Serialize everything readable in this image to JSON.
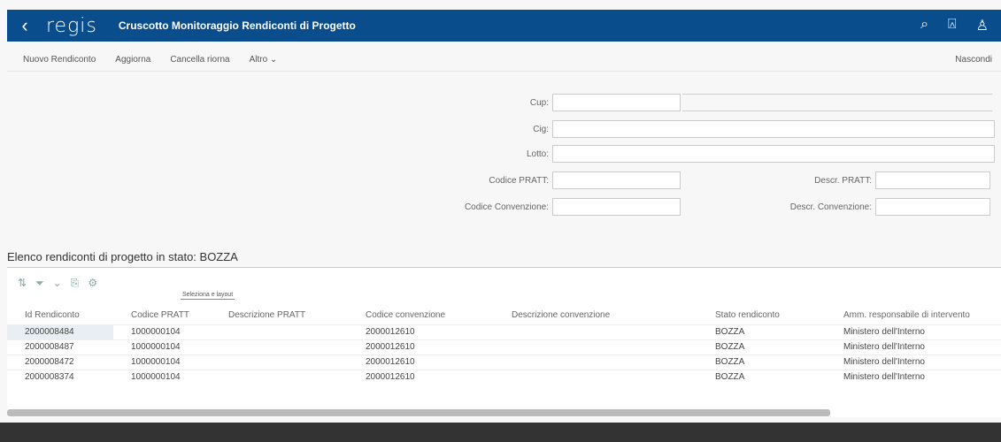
{
  "header": {
    "back_icon": "chevron-left-icon",
    "logo": "regis",
    "title": "Cruscotto Monitoraggio Rendiconti di Progetto",
    "icons": [
      "search-icon",
      "bell-icon",
      "user-icon"
    ]
  },
  "toolbar": {
    "items": [
      "Nuovo Rendiconto",
      "Aggiorna",
      "Cancella riorna",
      "Altro"
    ],
    "right": "Nascondi"
  },
  "form": {
    "cup_label": "Cup:",
    "cig_label": "Cig:",
    "lotto_label": "Lotto:",
    "pratt_label": "Codice PRATT:",
    "descr_pratt_label": "Descr. PRATT:",
    "conv_label": "Codice Convenzione:",
    "descr_conv_label": "Descr. Convenzione:"
  },
  "table": {
    "title": "Elenco rendiconti di progetto in stato: BOZZA",
    "tooltip": "Seleziona e layout",
    "columns": [
      "Id Rendiconto",
      "Codice PRATT",
      "Descrizione PRATT",
      "Codice convenzione",
      "Descrizione convenzione",
      "Stato rendiconto",
      "Amm. responsabile di intervento"
    ],
    "rows": [
      [
        "2000008484",
        "1000000104",
        "",
        "2000012610",
        "",
        "BOZZA",
        "Ministero dell'Interno"
      ],
      [
        "2000008487",
        "1000000104",
        "",
        "2000012610",
        "",
        "BOZZA",
        "Ministero dell'Interno"
      ],
      [
        "2000008472",
        "1000000104",
        "",
        "2000012610",
        "",
        "BOZZA",
        "Ministero dell'Interno"
      ],
      [
        "2000008374",
        "1000000104",
        "",
        "2000012610",
        "",
        "BOZZA",
        "Ministero dell'Interno"
      ]
    ]
  }
}
